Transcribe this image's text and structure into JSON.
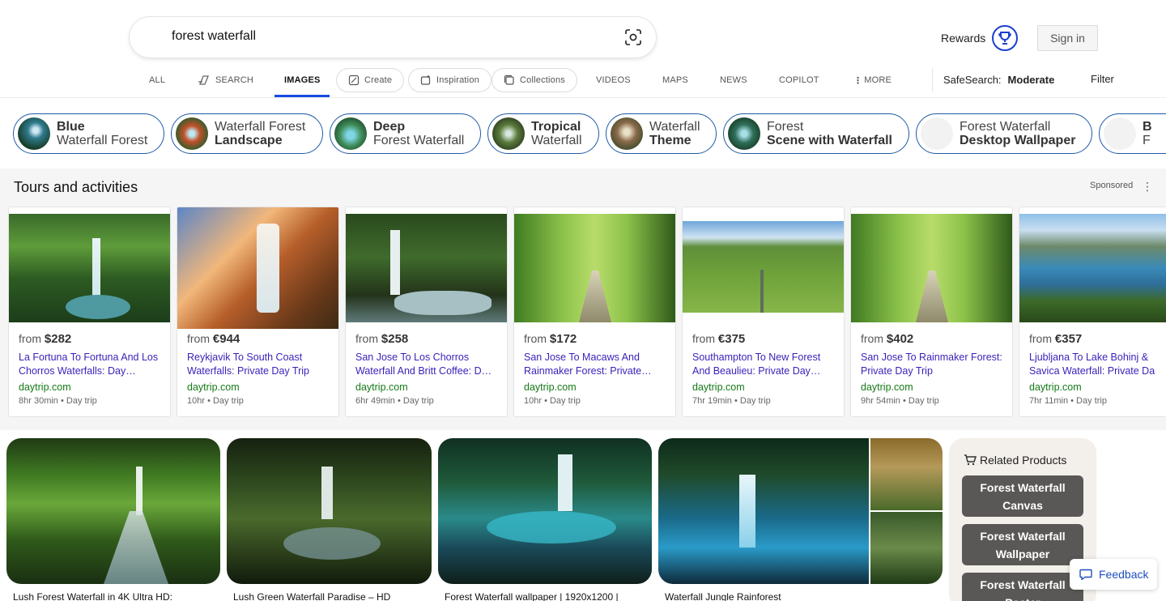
{
  "search": {
    "query": "forest waterfall"
  },
  "header": {
    "rewards_label": "Rewards",
    "signin_label": "Sign in"
  },
  "tabs": [
    {
      "label": "ALL"
    },
    {
      "label": "SEARCH"
    },
    {
      "label": "IMAGES"
    },
    {
      "label": "Create"
    },
    {
      "label": "Inspiration"
    },
    {
      "label": "Collections"
    },
    {
      "label": "VIDEOS"
    },
    {
      "label": "MAPS"
    },
    {
      "label": "NEWS"
    },
    {
      "label": "COPILOT"
    },
    {
      "label": "MORE"
    }
  ],
  "safesearch": {
    "label": "SafeSearch:",
    "value": "Moderate",
    "filter_label": "Filter"
  },
  "chips": [
    {
      "bold": "Blue",
      "rest": "Waterfall Forest",
      "bold_first": true
    },
    {
      "bold": "Landscape",
      "rest": "Waterfall Forest",
      "bold_first": false
    },
    {
      "bold": "Deep",
      "rest": "Forest Waterfall",
      "bold_first": true
    },
    {
      "bold": "Tropical",
      "rest": "Waterfall",
      "bold_first": true
    },
    {
      "bold": "Theme",
      "rest": "Waterfall",
      "bold_first": false
    },
    {
      "bold": "Scene with Waterfall",
      "rest": "Forest",
      "bold_first": false
    },
    {
      "bold": "Desktop Wallpaper",
      "rest": "Forest Waterfall",
      "bold_first": false
    },
    {
      "bold": "B",
      "rest": "F",
      "bold_first": true
    }
  ],
  "tours": {
    "title": "Tours and activities",
    "sponsored": "Sponsored",
    "cards": [
      {
        "from": "from",
        "price": "$282",
        "title": "La Fortuna To Fortuna And Los Chorros Waterfalls: Day…",
        "site": "daytrip.com",
        "meta": "8hr 30min • Day trip"
      },
      {
        "from": "from",
        "price": "€944",
        "title": "Reykjavik To South Coast Waterfalls: Private Day Trip",
        "site": "daytrip.com",
        "meta": "10hr • Day trip"
      },
      {
        "from": "from",
        "price": "$258",
        "title": "San Jose To Los Chorros Waterfall And Britt Coffee: D…",
        "site": "daytrip.com",
        "meta": "6hr 49min • Day trip"
      },
      {
        "from": "from",
        "price": "$172",
        "title": "San Jose To Macaws And Rainmaker Forest: Private…",
        "site": "daytrip.com",
        "meta": "10hr • Day trip"
      },
      {
        "from": "from",
        "price": "€375",
        "title": "Southampton To New Forest And Beaulieu: Private Day…",
        "site": "daytrip.com",
        "meta": "7hr 19min • Day trip"
      },
      {
        "from": "from",
        "price": "$402",
        "title": "San Jose To Rainmaker Forest: Private Day Trip",
        "site": "daytrip.com",
        "meta": "9hr 54min • Day trip"
      },
      {
        "from": "from",
        "price": "€357",
        "title": "Ljubljana To Lake Bohinj & Savica Waterfall: Private Da",
        "site": "daytrip.com",
        "meta": "7hr 11min • Day trip"
      }
    ]
  },
  "results": [
    {
      "caption": "Lush Forest Waterfall in 4K Ultra HD:"
    },
    {
      "caption": "Lush Green Waterfall Paradise – HD"
    },
    {
      "caption": "Forest Waterfall wallpaper | 1920x1200 |"
    },
    {
      "caption": "Waterfall Jungle Rainforest"
    }
  ],
  "related_products": {
    "title": "Related Products",
    "items": [
      {
        "label": "Forest Waterfall Canvas"
      },
      {
        "label": "Forest Waterfall Wallpaper"
      },
      {
        "label": "Forest Waterfall Poster"
      }
    ]
  },
  "feedback_label": "Feedback",
  "colors": {
    "accent": "#174ae4",
    "link": "#3b1fb8",
    "site": "#157a16",
    "chip_border": "#1f5aa8"
  }
}
